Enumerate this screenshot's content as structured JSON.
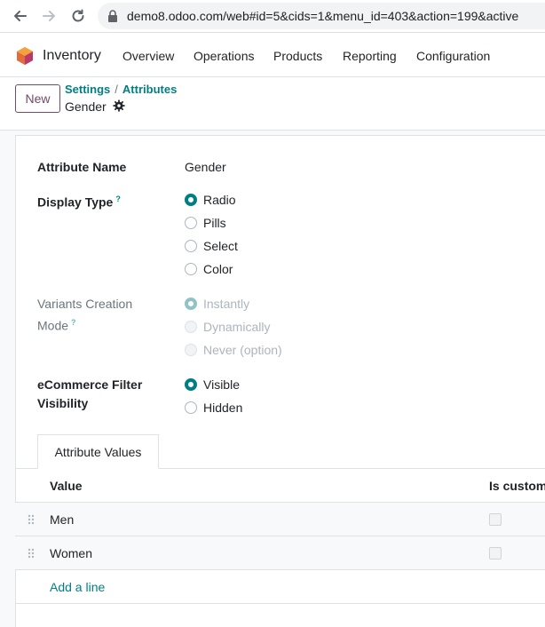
{
  "browser": {
    "url": "demo8.odoo.com/web#id=5&cids=1&menu_id=403&action=199&active"
  },
  "navbar": {
    "app_name": "Inventory",
    "menu": [
      "Overview",
      "Operations",
      "Products",
      "Reporting",
      "Configuration"
    ]
  },
  "control": {
    "new_label": "New",
    "breadcrumb": [
      "Settings",
      "Attributes"
    ],
    "separator": "/",
    "record_title": "Gender"
  },
  "form": {
    "attribute_name_label": "Attribute Name",
    "attribute_name_value": "Gender",
    "display_type": {
      "label": "Display Type",
      "help": "?",
      "options": [
        "Radio",
        "Pills",
        "Select",
        "Color"
      ],
      "selected": "Radio"
    },
    "variants_mode": {
      "label_line1": "Variants Creation",
      "label_line2": "Mode",
      "help": "?",
      "options": [
        "Instantly",
        "Dynamically",
        "Never (option)"
      ],
      "selected": "Instantly"
    },
    "ecommerce": {
      "label_line1": "eCommerce Filter",
      "label_line2": "Visibility",
      "options": [
        "Visible",
        "Hidden"
      ],
      "selected": "Visible"
    }
  },
  "notebook": {
    "tab_label": "Attribute Values",
    "columns": [
      "Value",
      "Is custom"
    ],
    "rows": [
      {
        "value": "Men",
        "is_custom": false
      },
      {
        "value": "Women",
        "is_custom": false
      }
    ],
    "add_line": "Add a line"
  },
  "colors": {
    "primary": "#714b67",
    "link": "#017e84"
  }
}
